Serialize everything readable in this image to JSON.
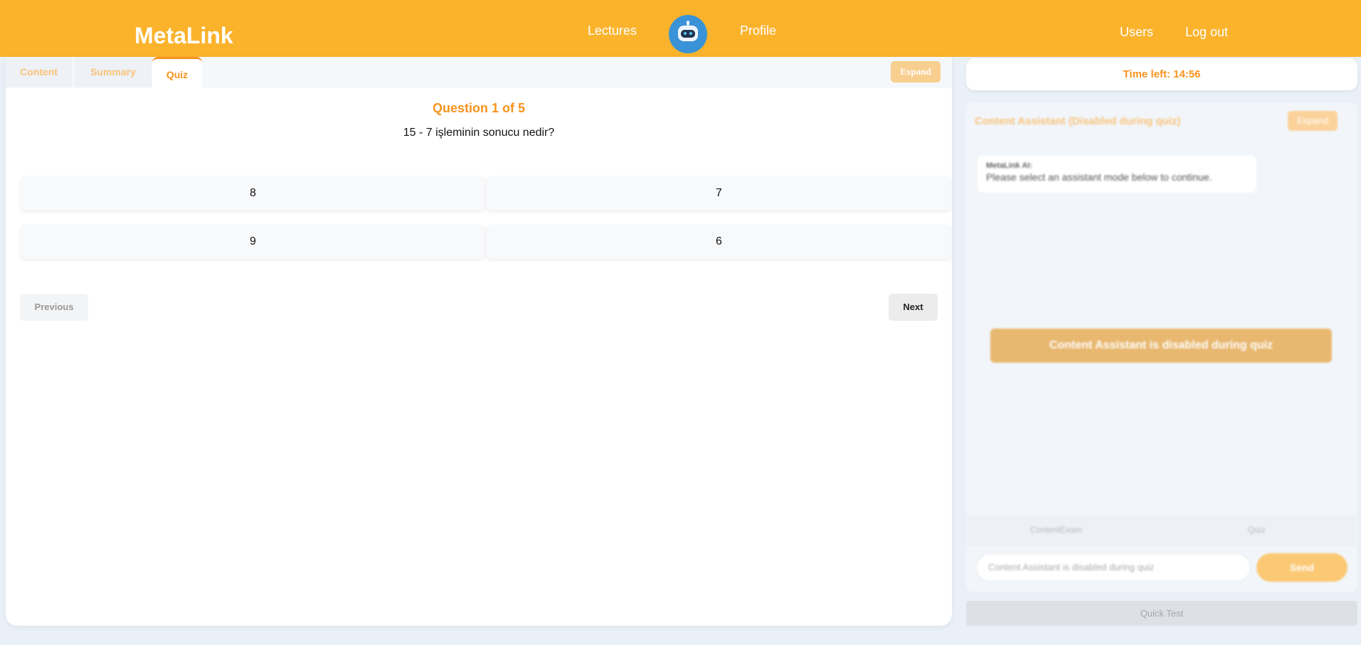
{
  "header": {
    "brand": "MetaLink",
    "nav_lectures": "Lectures",
    "nav_profile": "Profile",
    "nav_users": "Users",
    "nav_logout": "Log out",
    "accent_color": "#fbb32c"
  },
  "tabs": {
    "content": "Content",
    "summary": "Summary",
    "quiz": "Quiz",
    "active": "Quiz",
    "expand_label": "Expand"
  },
  "quiz": {
    "progress": "Question 1 of 5",
    "question": "15 - 7 işleminin sonucu nedir?",
    "answers": [
      "8",
      "7",
      "9",
      "6"
    ],
    "previous_label": "Previous",
    "next_label": "Next"
  },
  "timer": {
    "label": "Time left: 14:56"
  },
  "assistant": {
    "title": "Content Assistant (Disabled during quiz)",
    "expand_label": "Expand",
    "message_sender": "MetaLink AI:",
    "message_text": "Please select an assistant mode below to continue.",
    "disabled_banner": "Content Assistant is disabled during quiz",
    "modes": [
      "ContentExam",
      "Quiz"
    ],
    "input_placeholder": "Content Assistant is disabled during quiz",
    "send_label": "Send"
  },
  "quick_test": {
    "label": "Quick Test"
  },
  "icons": {
    "logo": "robot-icon"
  }
}
